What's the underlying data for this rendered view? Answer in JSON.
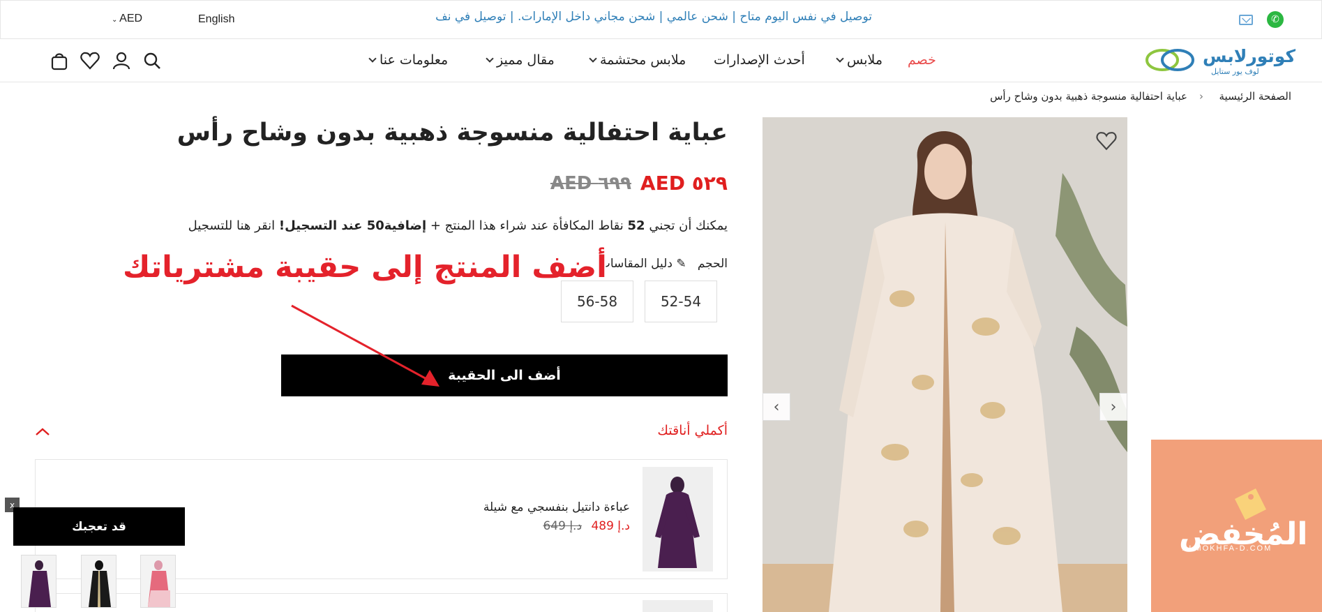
{
  "topbar": {
    "announcement": "توصيل في نفس اليوم متاح | شحن عالمي | شحن مجاني داخل الإمارات. | توصيل في نف",
    "language": "English",
    "currency": "AED",
    "icons": [
      "whatsapp-icon",
      "mail-icon"
    ]
  },
  "brand": {
    "name": "كوتورلابس",
    "tagline": "لوف يور ستايل",
    "accent": "#2f7fb7"
  },
  "nav": {
    "items": [
      {
        "label": "خصم",
        "has_dropdown": false
      },
      {
        "label": "ملابس",
        "has_dropdown": true
      },
      {
        "label": "أحدث الإصدارات",
        "has_dropdown": false
      },
      {
        "label": "ملابس محتشمة",
        "has_dropdown": true
      },
      {
        "label": "مقال مميز",
        "has_dropdown": true
      },
      {
        "label": "معلومات عنا",
        "has_dropdown": true
      }
    ],
    "icons": [
      "search-icon",
      "account-icon",
      "wishlist-icon",
      "bag-icon"
    ]
  },
  "breadcrumb": {
    "home": "الصفحة الرئيسية",
    "separator": "›",
    "current": "عباية احتفالية منسوجة ذهبية بدون وشاح رأس"
  },
  "product": {
    "title": "عباية احتفالية منسوجة ذهبية بدون وشاح رأس",
    "price": "AED ٥٢٩",
    "old_price": "AED ٦٩٩",
    "reward_pre": "يمكنك أن تجني",
    "reward_points": "52",
    "reward_mid": "نقاط المكافأة عند شراء هذا المنتج +",
    "reward_extra": "إضافية50 عند التسجيل!",
    "reward_link": "انقر هنا للتسجيل",
    "size_label": "الحجم",
    "size_guide": "دليل المقاسات",
    "sizes": [
      "52-54",
      "56-58"
    ],
    "add_to_bag": "أضف الى الحقيبة",
    "price_color": "#e01f1f"
  },
  "annotation": {
    "text": "أضف المنتج إلى حقيبة مشترياتك",
    "color": "#e4222b"
  },
  "complete_look": {
    "label": "أكملي أناقتك",
    "items": [
      {
        "name": "عباءة دانتيل بنفسجي مع شيلة",
        "price": "د.إ 489",
        "old_price": "د.إ 649"
      }
    ]
  },
  "may_like": {
    "close": "x",
    "label": "قد تعجبك",
    "thumbs": 3
  },
  "watermark": {
    "text": "المُخفض",
    "sub": "ALMOKHFA-D.COM",
    "color": "#f2a07a"
  }
}
